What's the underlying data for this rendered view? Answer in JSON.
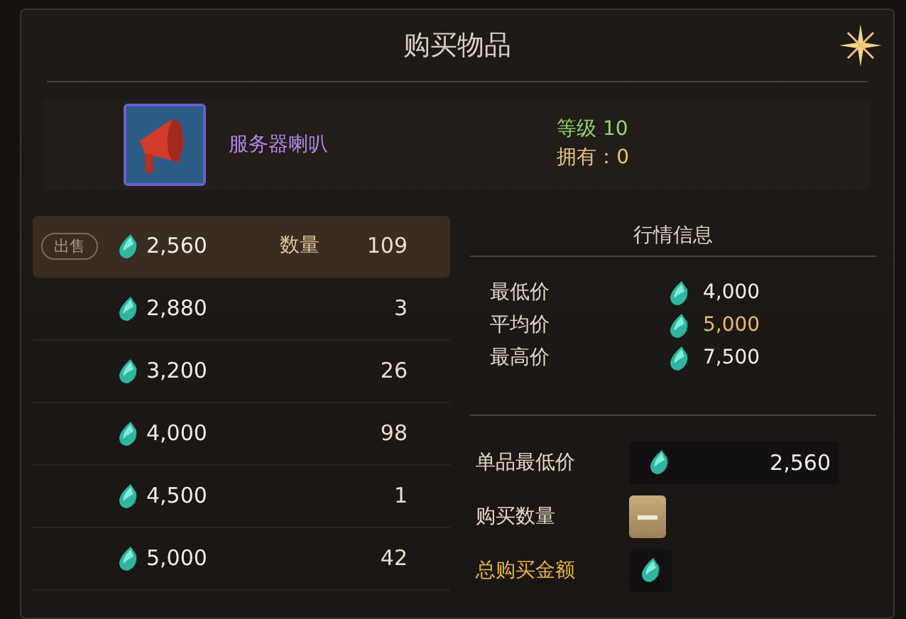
{
  "window": {
    "title": "购买物品"
  },
  "item": {
    "name": "服务器喇叭",
    "level": "等级 10",
    "owned": "拥有：0"
  },
  "listings": [
    {
      "sell_button": "出售",
      "price": "2,560",
      "quantity_label": "数量",
      "quantity": "109",
      "selected": true
    },
    {
      "price": "2,880",
      "quantity": "3",
      "selected": false
    },
    {
      "price": "3,200",
      "quantity": "26",
      "selected": false
    },
    {
      "price": "4,000",
      "quantity": "98",
      "selected": false
    },
    {
      "price": "4,500",
      "quantity": "1",
      "selected": false
    },
    {
      "price": "5,000",
      "quantity": "42",
      "selected": false
    }
  ],
  "market": {
    "title": "行情信息",
    "stats": [
      {
        "label": "最低价",
        "value": "4,000",
        "highlighted": false
      },
      {
        "label": "平均价",
        "value": "5,000",
        "highlighted": true
      },
      {
        "label": "最高价",
        "value": "7,500",
        "highlighted": false
      }
    ]
  },
  "purchase": [
    {
      "kind": "price",
      "label": "单品最低价",
      "value": "2,560"
    },
    {
      "kind": "quantity",
      "label": "购买数量"
    },
    {
      "kind": "total",
      "label": "总购买金额"
    }
  ]
}
